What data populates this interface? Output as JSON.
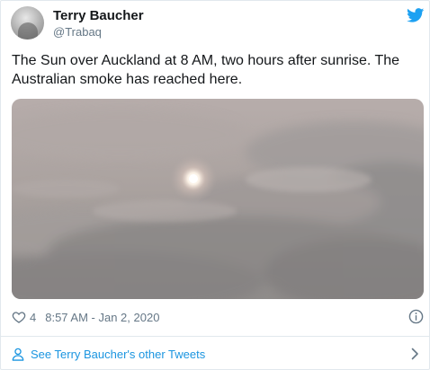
{
  "tweet": {
    "author_name": "Terry Baucher",
    "author_handle": "@Trabaq",
    "text": "The Sun over Auckland at 8 AM, two hours after sunrise. The Australian smoke has reached here.",
    "like_count": "4",
    "timestamp": "8:57 AM - Jan 2, 2020",
    "footer_link": "See Terry Baucher's other Tweets"
  },
  "icons": {
    "brand": "twitter-bird-icon",
    "like": "heart-icon",
    "info": "info-icon",
    "profile": "person-icon",
    "more": "chevron-right-icon"
  },
  "colors": {
    "brand": "#1da1f2",
    "link": "#1b95e0",
    "secondary_text": "#657786",
    "border": "#e1e8ed"
  }
}
